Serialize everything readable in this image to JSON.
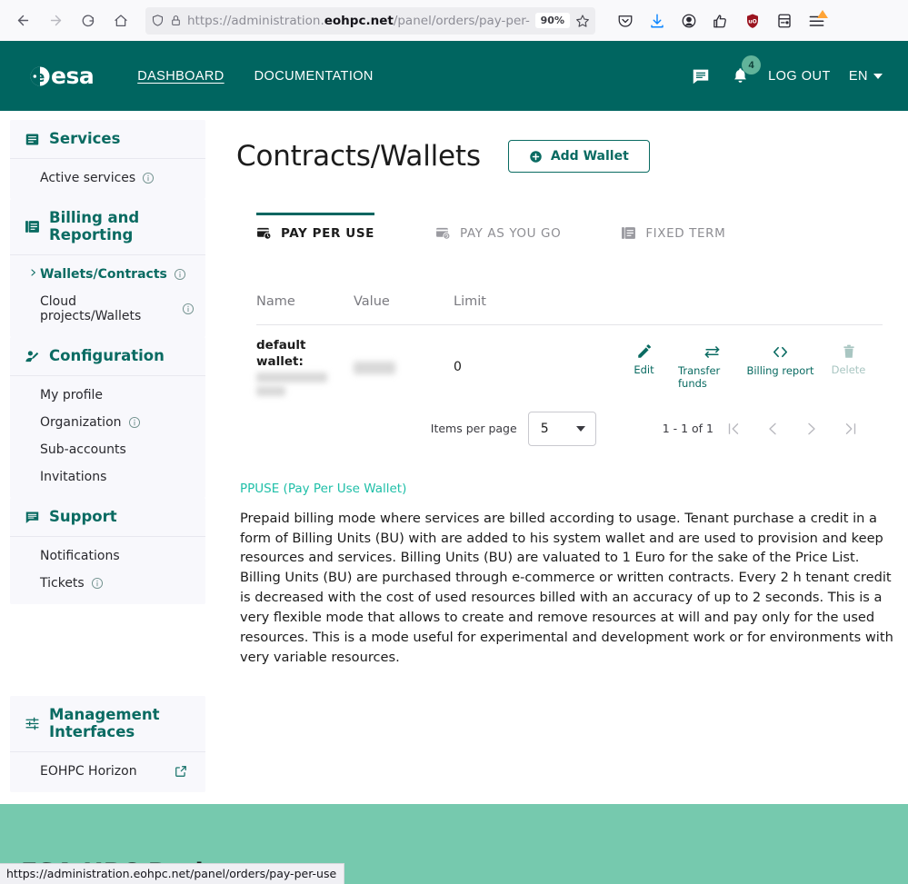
{
  "browser": {
    "back_icon": "back-arrow-icon",
    "forward_icon": "forward-arrow-icon",
    "reload_icon": "reload-icon",
    "home_icon": "home-icon",
    "shield_icon": "tracking-protection-shield-icon",
    "lock_icon": "padlock-icon",
    "url_prefix": "https://administration.",
    "url_domain": "eohpc.net",
    "url_suffix": "/panel/orders/pay-per-",
    "zoom_level": "90%",
    "bookmark_icon": "star-icon",
    "toolbar_icons": [
      "pocket-icon",
      "downloads-icon",
      "account-icon",
      "extensions-icon",
      "ublock-origin-icon",
      "save-to-device-icon",
      "app-menu-icon"
    ],
    "status_url": "https://administration.eohpc.net/panel/orders/pay-per-use"
  },
  "header": {
    "logo_text": "esa",
    "nav": [
      {
        "label": "DASHBOARD",
        "active": true
      },
      {
        "label": "DOCUMENTATION",
        "active": false
      }
    ],
    "chat_icon": "chat-bubble-icon",
    "bell_icon": "notification-bell-icon",
    "notification_count": "4",
    "logout_label": "LOG OUT",
    "language": "EN",
    "bg_color": "#006560"
  },
  "sidebar": {
    "sections": [
      {
        "title": "Services",
        "icon": "article-list-icon",
        "items": [
          {
            "label": "Active services",
            "info": true,
            "active": false
          }
        ]
      },
      {
        "title": "Billing and Reporting",
        "icon": "billing-documents-icon",
        "items": [
          {
            "label": "Wallets/Contracts",
            "info": true,
            "active": true
          },
          {
            "label": "Cloud projects/Wallets",
            "info": true,
            "active": false
          }
        ]
      },
      {
        "title": "Configuration",
        "icon": "person-edit-icon",
        "items": [
          {
            "label": "My profile",
            "info": false,
            "active": false
          },
          {
            "label": "Organization",
            "info": true,
            "active": false
          },
          {
            "label": "Sub-accounts",
            "info": false,
            "active": false
          },
          {
            "label": "Invitations",
            "info": false,
            "active": false
          }
        ]
      },
      {
        "title": "Support",
        "icon": "support-chat-icon",
        "items": [
          {
            "label": "Notifications",
            "info": false,
            "active": false
          },
          {
            "label": "Tickets",
            "info": true,
            "active": false
          }
        ]
      },
      {
        "title": "Management Interfaces",
        "icon": "sliders-icon",
        "items": [
          {
            "label": "EOHPC Horizon",
            "info": false,
            "active": false,
            "external": true
          }
        ]
      }
    ]
  },
  "main": {
    "page_title": "Contracts/Wallets",
    "add_wallet_label": "Add Wallet",
    "add_wallet_icon": "plus-circle-icon",
    "tabs": [
      {
        "label": "PAY PER USE",
        "icon": "card-clock-icon",
        "active": true
      },
      {
        "label": "PAY AS YOU GO",
        "icon": "card-refresh-icon",
        "active": false
      },
      {
        "label": "FIXED TERM",
        "icon": "documents-icon",
        "active": false
      }
    ],
    "table": {
      "columns": [
        "Name",
        "Value",
        "Limit"
      ],
      "rows": [
        {
          "name": "default wallet:",
          "name_redacted": true,
          "value_redacted": true,
          "limit": "0",
          "actions": [
            {
              "label": "Edit",
              "icon": "pencil-icon",
              "disabled": false
            },
            {
              "label": "Transfer funds",
              "icon": "transfer-arrows-icon",
              "disabled": false
            },
            {
              "label": "Billing report",
              "icon": "code-brackets-icon",
              "disabled": false
            },
            {
              "label": "Delete",
              "icon": "trash-icon",
              "disabled": true
            }
          ]
        }
      ]
    },
    "paginator": {
      "items_per_page_label": "Items per page",
      "items_per_page_value": "5",
      "range_label": "1 - 1 of 1",
      "first_icon": "first-page-icon",
      "prev_icon": "previous-page-icon",
      "next_icon": "next-page-icon",
      "last_icon": "last-page-icon"
    },
    "info": {
      "title": "PPUSE (Pay Per Use Wallet)",
      "title_color": "#1fbfa8",
      "body": "Prepaid billing mode where services are billed according to usage. Tenant purchase a credit in a form of Billing Units (BU) with are added to his system wallet and are used to provision and keep resources and services. Billing Units (BU) are valuated to 1 Euro for the sake of the Price List. Billing Units (BU) are purchased through e-commerce or written contracts. Every 2 h tenant credit is decreased with the cost of used resources billed with an accuracy of up to 2 seconds. This is a very flexible mode that allows to create and remove resources at will and pay only for the used resources. This is a mode useful for experimental and development work or for environments with very variable resources."
    }
  },
  "footer": {
    "title": "ESA HPC Project",
    "bg_color": "#76c9ae"
  }
}
